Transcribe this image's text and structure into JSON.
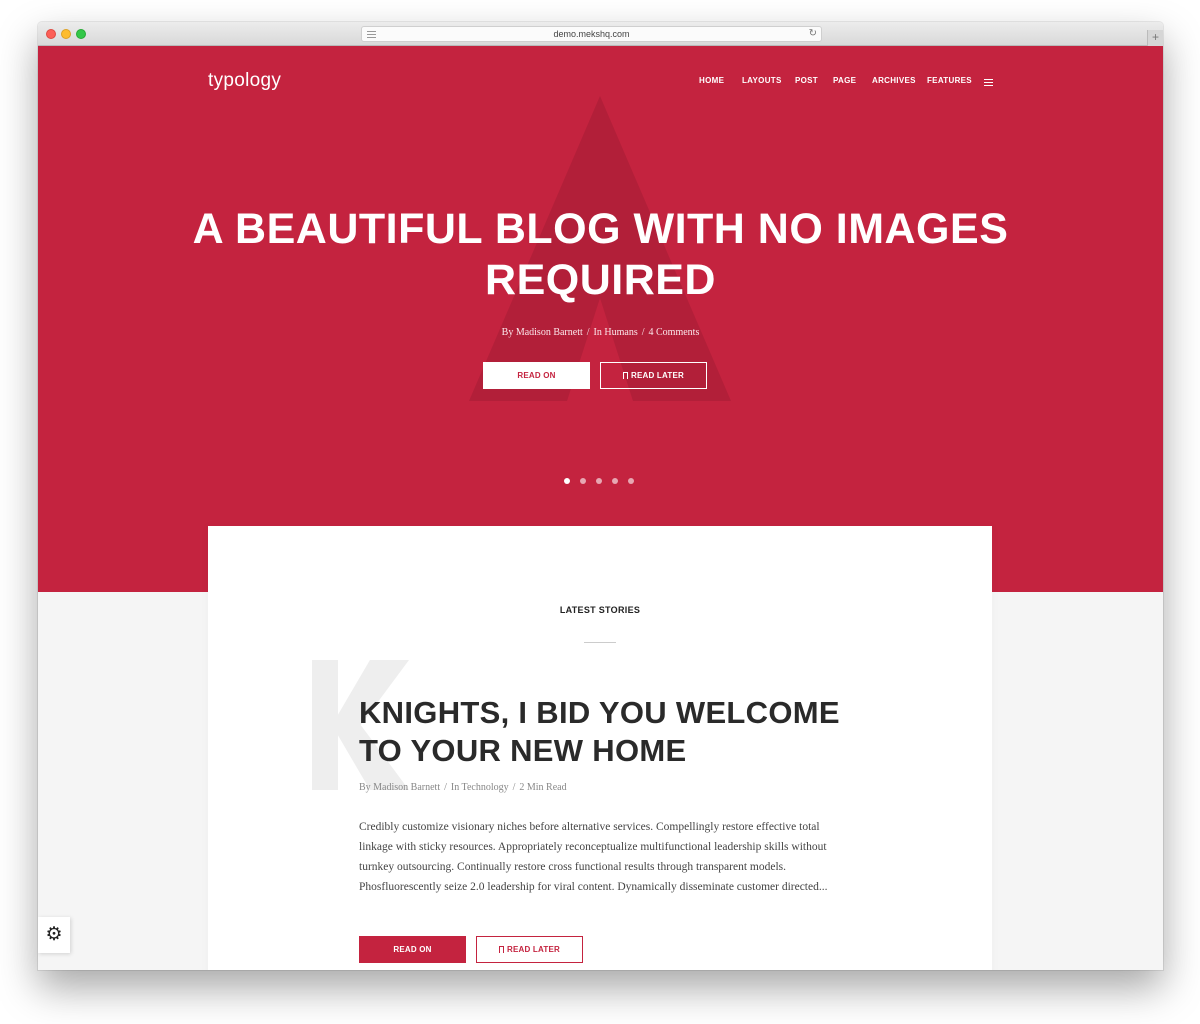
{
  "browser": {
    "url": "demo.mekshq.com",
    "reload_icon": "reload-icon",
    "new_tab_label": "+"
  },
  "site": {
    "logo": "typology",
    "nav": [
      "HOME",
      "LAYOUTS",
      "POST",
      "PAGE",
      "ARCHIVES",
      "FEATURES"
    ],
    "menu_icon": "hamburger-icon"
  },
  "hero": {
    "title": "A BEAUTIFUL BLOG WITH NO IMAGES REQUIRED",
    "meta": {
      "author": "By Madison Barnett",
      "separator": "/",
      "category": "In Humans",
      "comments": "4 Comments"
    },
    "read_on": "READ ON",
    "read_later": "READ LATER",
    "slides": 5,
    "active_slide": 1
  },
  "latest": {
    "section_title": "LATEST STORIES",
    "post": {
      "title": "KNIGHTS, I BID YOU WELCOME TO YOUR NEW HOME",
      "meta": {
        "author": "By Madison Barnett",
        "separator": "/",
        "category": "In Technology",
        "read_time": "2 Min Read"
      },
      "excerpt": "Credibly customize visionary niches before alternative services. Compellingly restore effective total linkage with sticky resources. Appropriately reconceptualize multifunctional leadership skills without turnkey outsourcing. Continually restore cross functional results through transparent models. Phosfluorescently seize 2.0 leadership for viral content. Dynamically disseminate customer directed...",
      "read_on": "READ ON",
      "read_later": "READ LATER"
    }
  },
  "colors": {
    "accent": "#c4233f",
    "accent_dark": "#b21f39",
    "background": "#f5f5f5"
  }
}
